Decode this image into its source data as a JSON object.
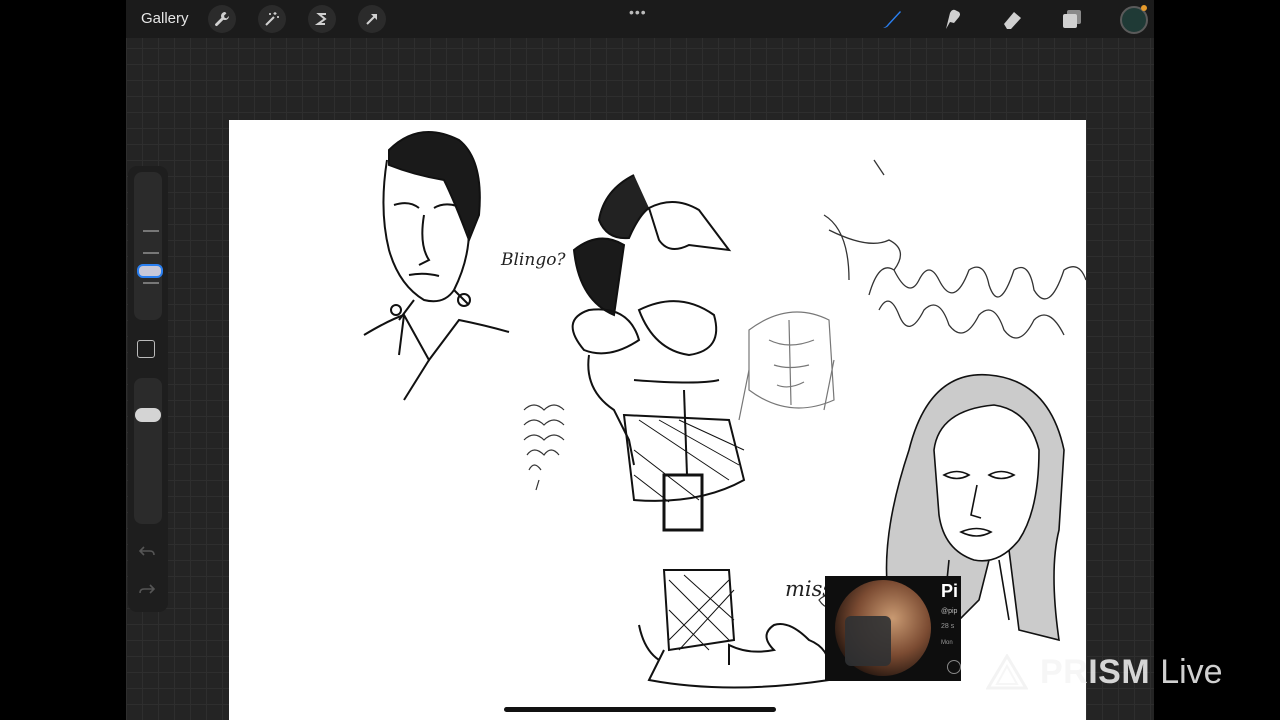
{
  "toolbar": {
    "gallery_label": "Gallery",
    "left_tools": [
      {
        "icon": "wrench-icon"
      },
      {
        "icon": "magic-wand-icon"
      },
      {
        "icon": "selection-s-icon"
      },
      {
        "icon": "arrow-cursor-icon"
      }
    ],
    "more_label": "•••",
    "right_tools": [
      {
        "icon": "brush-icon",
        "active": true
      },
      {
        "icon": "smudge-icon"
      },
      {
        "icon": "eraser-icon"
      },
      {
        "icon": "layers-icon"
      }
    ],
    "current_color": "#1f3a36"
  },
  "sidebar": {
    "modify_icon": "square-icon",
    "undo_icon": "undo-icon",
    "redo_icon": "redo-icon"
  },
  "canvas": {
    "annotations": {
      "blingo": "Blingo?",
      "miss_piper": "miss piper"
    }
  },
  "profile_overlay": {
    "name": "Pi",
    "handle": "@pip",
    "subscribers": "28 s",
    "date": "Mon"
  },
  "watermark": {
    "brand": "PRISM",
    "suffix": "Live"
  },
  "colors": {
    "accent": "#2a7ff0",
    "toolbar_bg": "#1b1b1b",
    "workspace_bg": "#242424"
  }
}
